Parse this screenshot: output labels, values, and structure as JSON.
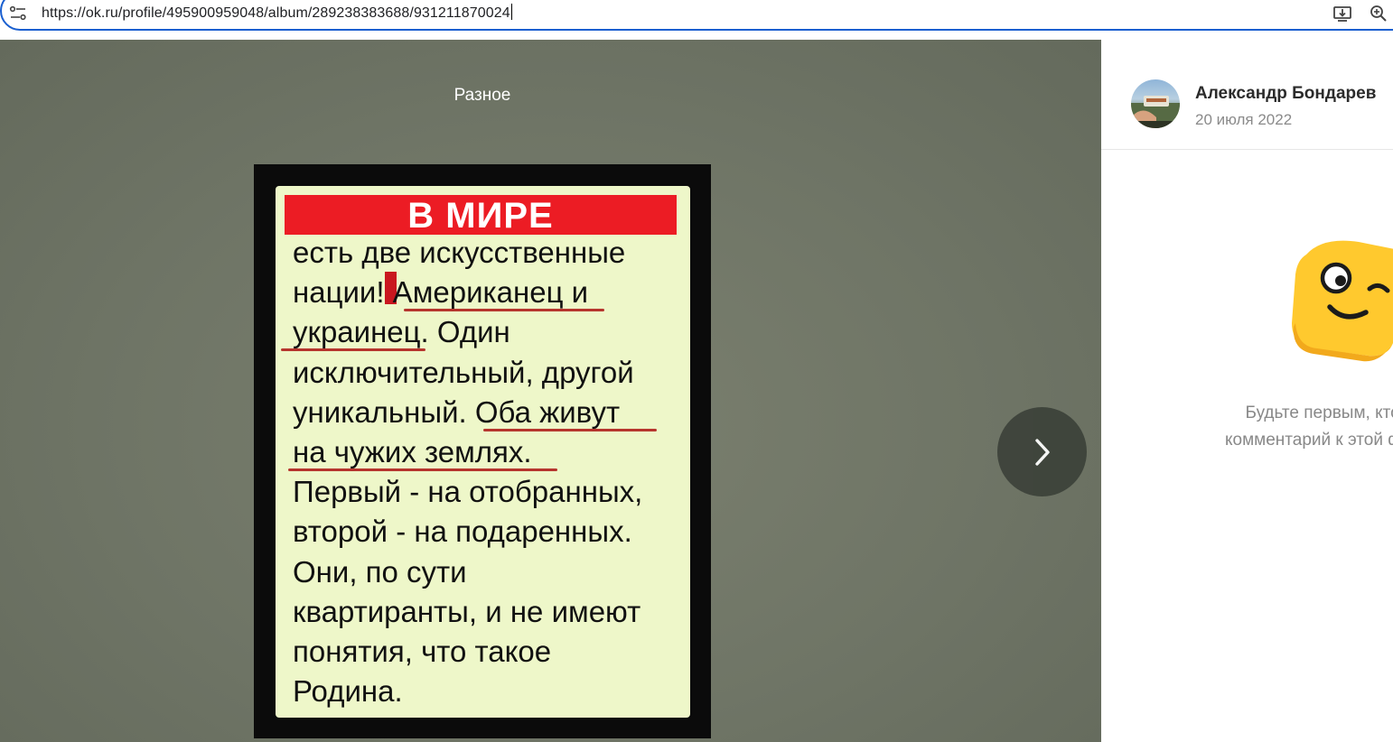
{
  "browser": {
    "url": "https://ok.ru/profile/495900959048/album/289238383688/931211870024",
    "icons": [
      "site-info-icon",
      "install-app-icon",
      "zoom-icon"
    ]
  },
  "viewer": {
    "album_title": "Разное",
    "photo": {
      "banner": "В МИРЕ",
      "text": "есть две искусственные\nнации! Американец и\nукраинец. Один\nисключительный, другой\nуникальный. Оба живут\nна чужих землях.\nПервый - на отобранных,\nвторой - на подаренных.\nОни, по сути\nквартиранты, и не имеют\nпонятия, что такое\nРодина."
    },
    "next_icon": "chevron-right-icon"
  },
  "sidebar": {
    "author_name": "Александр Бондарев",
    "date": "20 июля 2022",
    "empty_comments": "Будьте первым, кто оставит\nкомментарий к этой фотографии"
  },
  "colors": {
    "accent": "#1a5fd0",
    "banner_red": "#ec1c24",
    "poster_bg": "#eef7c9",
    "mascot_yellow": "#ffc92e"
  }
}
